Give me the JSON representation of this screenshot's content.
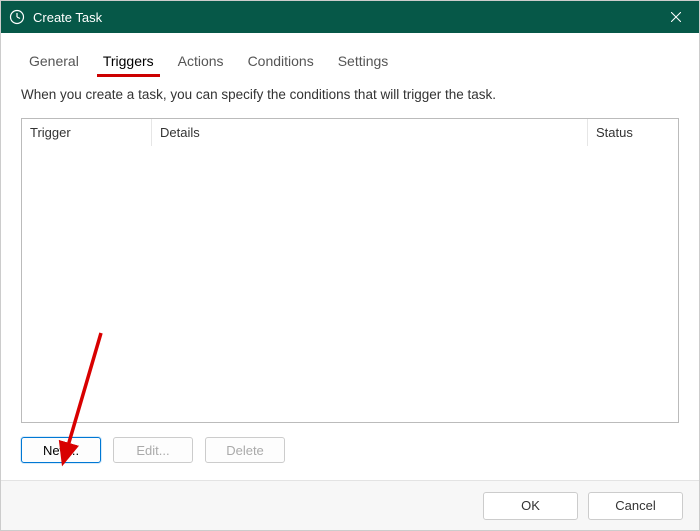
{
  "titlebar": {
    "title": "Create Task"
  },
  "tabs": {
    "items": [
      {
        "label": "General"
      },
      {
        "label": "Triggers"
      },
      {
        "label": "Actions"
      },
      {
        "label": "Conditions"
      },
      {
        "label": "Settings"
      }
    ],
    "active_index": 1
  },
  "description": "When you create a task, you can specify the conditions that will trigger the task.",
  "table": {
    "columns": {
      "trigger": "Trigger",
      "details": "Details",
      "status": "Status"
    }
  },
  "buttons": {
    "new": "New...",
    "edit": "Edit...",
    "delete": "Delete"
  },
  "footer": {
    "ok": "OK",
    "cancel": "Cancel"
  }
}
